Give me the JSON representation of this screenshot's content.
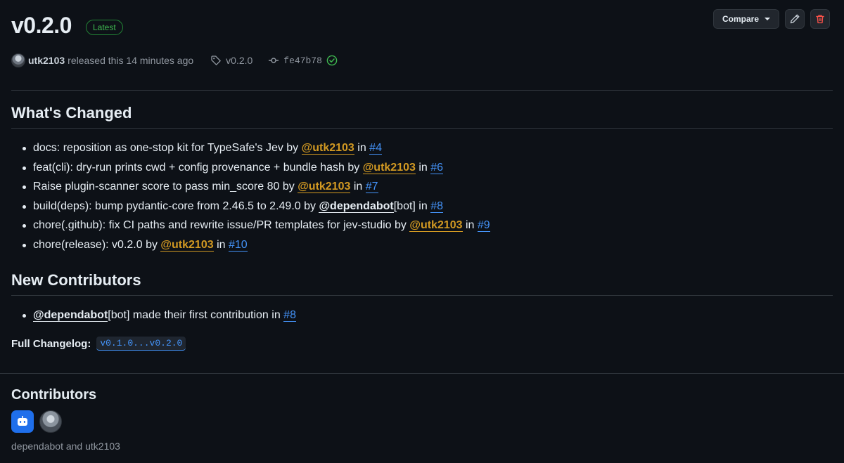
{
  "release": {
    "title": "v0.2.0",
    "badge": "Latest",
    "author": "utk2103",
    "released_text": "released this 14 minutes ago",
    "tag": "v0.2.0",
    "commit": "fe47b78"
  },
  "actions": {
    "compare_label": "Compare",
    "edit_icon": "pencil-icon",
    "delete_icon": "trash-icon"
  },
  "changes": {
    "title": "What's Changed",
    "items": [
      {
        "text": "docs: reposition as one-stop kit for TypeSafe's Jev by ",
        "mention": "@utk2103",
        "in": " in ",
        "pr": "#4"
      },
      {
        "text": "feat(cli): dry-run prints cwd + config provenance + bundle hash by ",
        "mention": "@utk2103",
        "in": " in ",
        "pr": "#6"
      },
      {
        "text": "Raise plugin-scanner score to pass min_score 80 by ",
        "mention": "@utk2103",
        "in": " in ",
        "pr": "#7"
      },
      {
        "text": "build(deps): bump pydantic-core from 2.46.5 to 2.49.0 by ",
        "mention": "@dependabot",
        "suffix": "[bot]",
        "in": " in ",
        "pr": "#8"
      },
      {
        "text": "chore(.github): fix CI paths and rewrite issue/PR templates for jev-studio by ",
        "mention": "@utk2103",
        "in": " in ",
        "pr": "#9"
      },
      {
        "text": "chore(release): v0.2.0 by ",
        "mention": "@utk2103",
        "in": " in ",
        "pr": "#10"
      }
    ]
  },
  "new_contributors": {
    "title": "New Contributors",
    "items": [
      {
        "mention": "@dependabot",
        "suffix": "[bot]",
        "text": " made their first contribution in ",
        "pr": "#8"
      }
    ]
  },
  "changelog": {
    "label": "Full Changelog:",
    "range": "v0.1.0...v0.2.0"
  },
  "contributors": {
    "title": "Contributors",
    "names": "dependabot and utk2103"
  },
  "colors": {
    "background": "#0d1117",
    "link": "#4493f8",
    "mention": "#d29922",
    "latest_badge": "#3fb950",
    "delete": "#f85149"
  }
}
